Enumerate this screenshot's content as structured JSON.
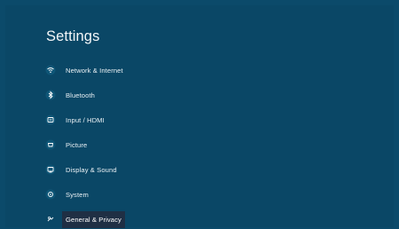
{
  "page": {
    "title": "Settings"
  },
  "menu": {
    "items": [
      {
        "label": "Network & Internet",
        "icon": "wifi-icon"
      },
      {
        "label": "Bluetooth",
        "icon": "bluetooth-icon"
      },
      {
        "label": "Input / HDMI",
        "icon": "input-icon"
      },
      {
        "label": "Picture",
        "icon": "picture-icon"
      },
      {
        "label": "Display & Sound",
        "icon": "display-icon"
      },
      {
        "label": "System",
        "icon": "system-icon"
      },
      {
        "label": "General & Privacy",
        "icon": "general-icon"
      }
    ],
    "selected": "General & Privacy"
  },
  "colors": {
    "background": "#0b4a6a",
    "selected_bg": "#1f2f44",
    "text": "#e9f0f4"
  }
}
